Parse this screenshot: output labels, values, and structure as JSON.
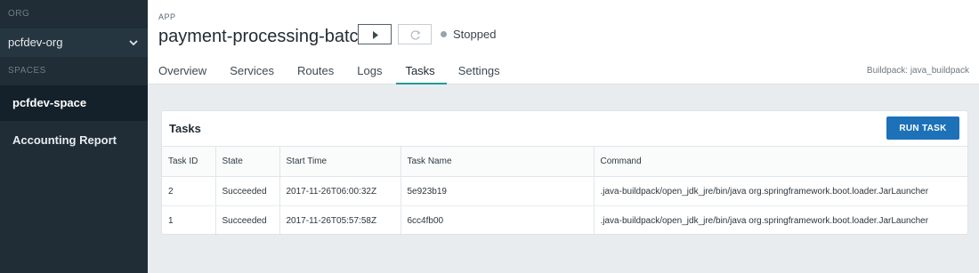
{
  "sidebar": {
    "org_section": "ORG",
    "org_name": "pcfdev-org",
    "spaces_section": "SPACES",
    "spaces": [
      {
        "label": "pcfdev-space"
      },
      {
        "label": "Accounting Report"
      }
    ]
  },
  "app": {
    "eyebrow": "APP",
    "name": "payment-processing-batch",
    "status": "Stopped"
  },
  "tabs": [
    "Overview",
    "Services",
    "Routes",
    "Logs",
    "Tasks",
    "Settings"
  ],
  "active_tab": "Tasks",
  "buildpack": "Buildpack: java_buildpack",
  "tasks_panel": {
    "title": "Tasks",
    "run_button": "RUN TASK",
    "columns": [
      "Task ID",
      "State",
      "Start Time",
      "Task Name",
      "Command"
    ],
    "rows": [
      [
        "2",
        "Succeeded",
        "2017-11-26T06:00:32Z",
        "5e923b19",
        ".java-buildpack/open_jdk_jre/bin/java org.springframework.boot.loader.JarLauncher"
      ],
      [
        "1",
        "Succeeded",
        "2017-11-26T05:57:58Z",
        "6cc4fb00",
        ".java-buildpack/open_jdk_jre/bin/java org.springframework.boot.loader.JarLauncher"
      ]
    ]
  },
  "colors": {
    "sidebar_bg": "#202d36",
    "accent_tab": "#1f9c97",
    "primary_button": "#1d71b8"
  }
}
